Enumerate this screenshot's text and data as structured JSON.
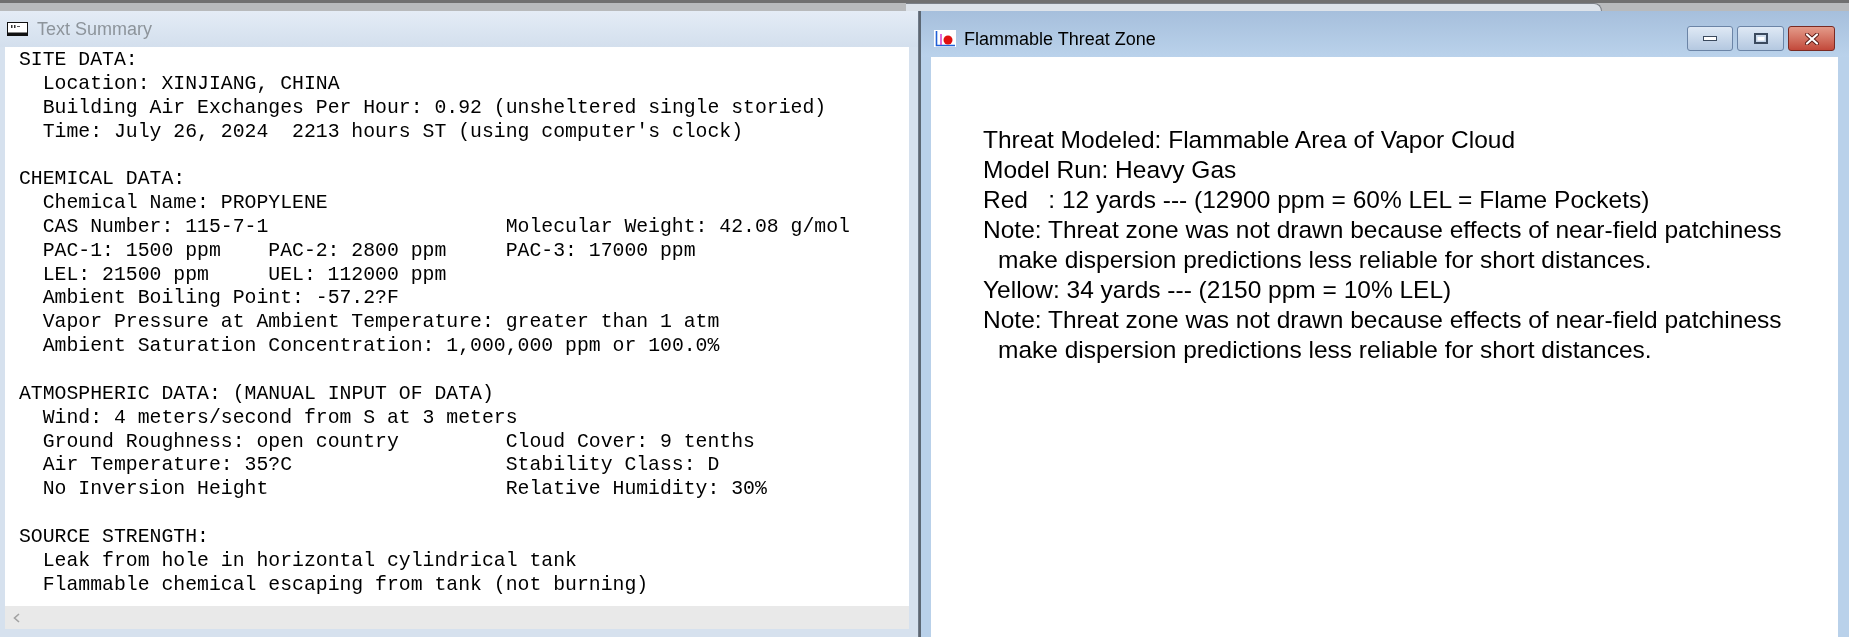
{
  "text_summary_window": {
    "title": "Text Summary",
    "sections": [
      {
        "heading": "SITE DATA:",
        "lines": [
          {
            "left": "Location: XINJIANG, CHINA"
          },
          {
            "left": "Building Air Exchanges Per Hour: 0.92 (unsheltered single storied)"
          },
          {
            "left": "Time: July 26, 2024  2213 hours ST (using computer's clock)"
          }
        ]
      },
      {
        "heading": "CHEMICAL DATA:",
        "lines": [
          {
            "left": "Chemical Name: PROPYLENE"
          },
          {
            "left": "CAS Number: 115-7-1",
            "right": "Molecular Weight: 42.08 g/mol"
          },
          {
            "left": "PAC-1: 1500 ppm",
            "middle": "PAC-2: 2800 ppm",
            "right": "PAC-3: 17000 ppm"
          },
          {
            "left": "LEL: 21500 ppm",
            "middle": "UEL: 112000 ppm"
          },
          {
            "left": "Ambient Boiling Point: -57.2?F"
          },
          {
            "left": "Vapor Pressure at Ambient Temperature: greater than 1 atm"
          },
          {
            "left": "Ambient Saturation Concentration: 1,000,000 ppm or 100.0%"
          }
        ]
      },
      {
        "heading": "ATMOSPHERIC DATA: (MANUAL INPUT OF DATA)",
        "lines": [
          {
            "left": "Wind: 4 meters/second from S at 3 meters"
          },
          {
            "left": "Ground Roughness: open country",
            "right": "Cloud Cover: 9 tenths"
          },
          {
            "left": "Air Temperature: 35?C",
            "right": "Stability Class: D"
          },
          {
            "left": "No Inversion Height",
            "right": "Relative Humidity: 30%"
          }
        ]
      },
      {
        "heading": "SOURCE STRENGTH:",
        "lines": [
          {
            "left": "Leak from hole in horizontal cylindrical tank"
          },
          {
            "left": "Flammable chemical escaping from tank (not burning)"
          }
        ]
      }
    ]
  },
  "threat_zone_window": {
    "title": "Flammable Threat Zone",
    "lines": [
      {
        "kind": "text",
        "text": "Threat Modeled: Flammable Area of Vapor Cloud"
      },
      {
        "kind": "text",
        "text": "Model Run: Heavy Gas"
      },
      {
        "kind": "text",
        "text": "Red   : 12 yards --- (12900 ppm = 60% LEL = Flame Pockets)"
      },
      {
        "kind": "note",
        "text": "Note: Threat zone was not drawn because effects of near-field patchiness make dispersion predictions less reliable for short distances."
      },
      {
        "kind": "text",
        "text": "Yellow: 34 yards --- (2150 ppm = 10% LEL)"
      },
      {
        "kind": "note",
        "text": "Note: Threat zone was not drawn because effects of near-field patchiness make dispersion predictions less reliable for short distances."
      }
    ]
  }
}
